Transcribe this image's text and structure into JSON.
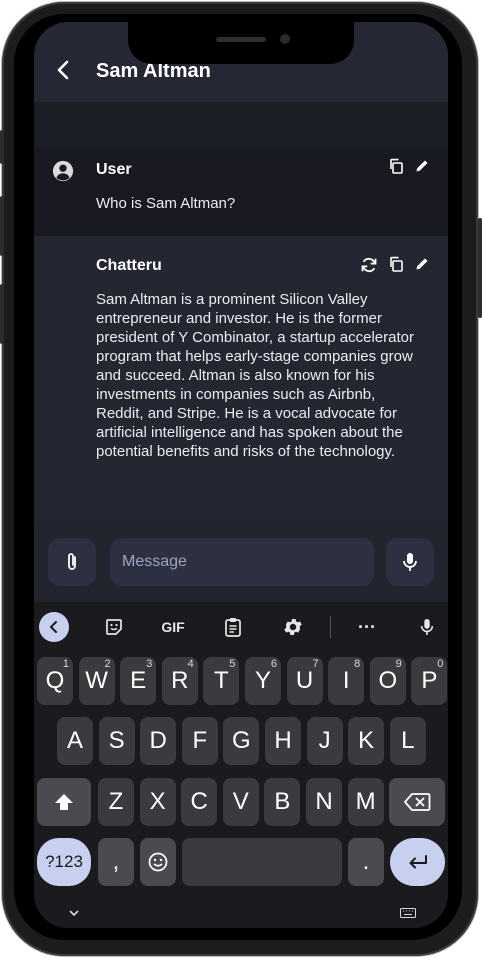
{
  "chat": {
    "title": "Sam Altman",
    "messages": [
      {
        "sender": "User",
        "text": "Who is Sam Altman?"
      },
      {
        "sender": "Chatteru",
        "text": "Sam Altman is a prominent Silicon Valley entrepreneur and investor. He is the former president of Y Combinator, a startup accelerator program that helps early-stage companies grow and succeed. Altman is also known for his investments in companies such as Airbnb, Reddit, and Stripe. He is a vocal advocate for artificial intelligence and has spoken about the potential benefits and risks of the technology."
      }
    ]
  },
  "composer": {
    "placeholder": "Message",
    "value": ""
  },
  "keyboard": {
    "toolbar": {
      "gif_label": "GIF",
      "more_label": "···"
    },
    "row1": [
      {
        "k": "Q",
        "s": "1"
      },
      {
        "k": "W",
        "s": "2"
      },
      {
        "k": "E",
        "s": "3"
      },
      {
        "k": "R",
        "s": "4"
      },
      {
        "k": "T",
        "s": "5"
      },
      {
        "k": "Y",
        "s": "6"
      },
      {
        "k": "U",
        "s": "7"
      },
      {
        "k": "I",
        "s": "8"
      },
      {
        "k": "O",
        "s": "9"
      },
      {
        "k": "P",
        "s": "0"
      }
    ],
    "row2": [
      "A",
      "S",
      "D",
      "F",
      "G",
      "H",
      "J",
      "K",
      "L"
    ],
    "row3": [
      "Z",
      "X",
      "C",
      "V",
      "B",
      "N",
      "M"
    ],
    "symbols_label": "?123",
    "comma_label": ",",
    "period_label": ".",
    "space_label": ""
  },
  "colors": {
    "accent": "#c7d0ee",
    "screen_bg": "#1c1e26",
    "key_bg": "#3b3b3f"
  }
}
